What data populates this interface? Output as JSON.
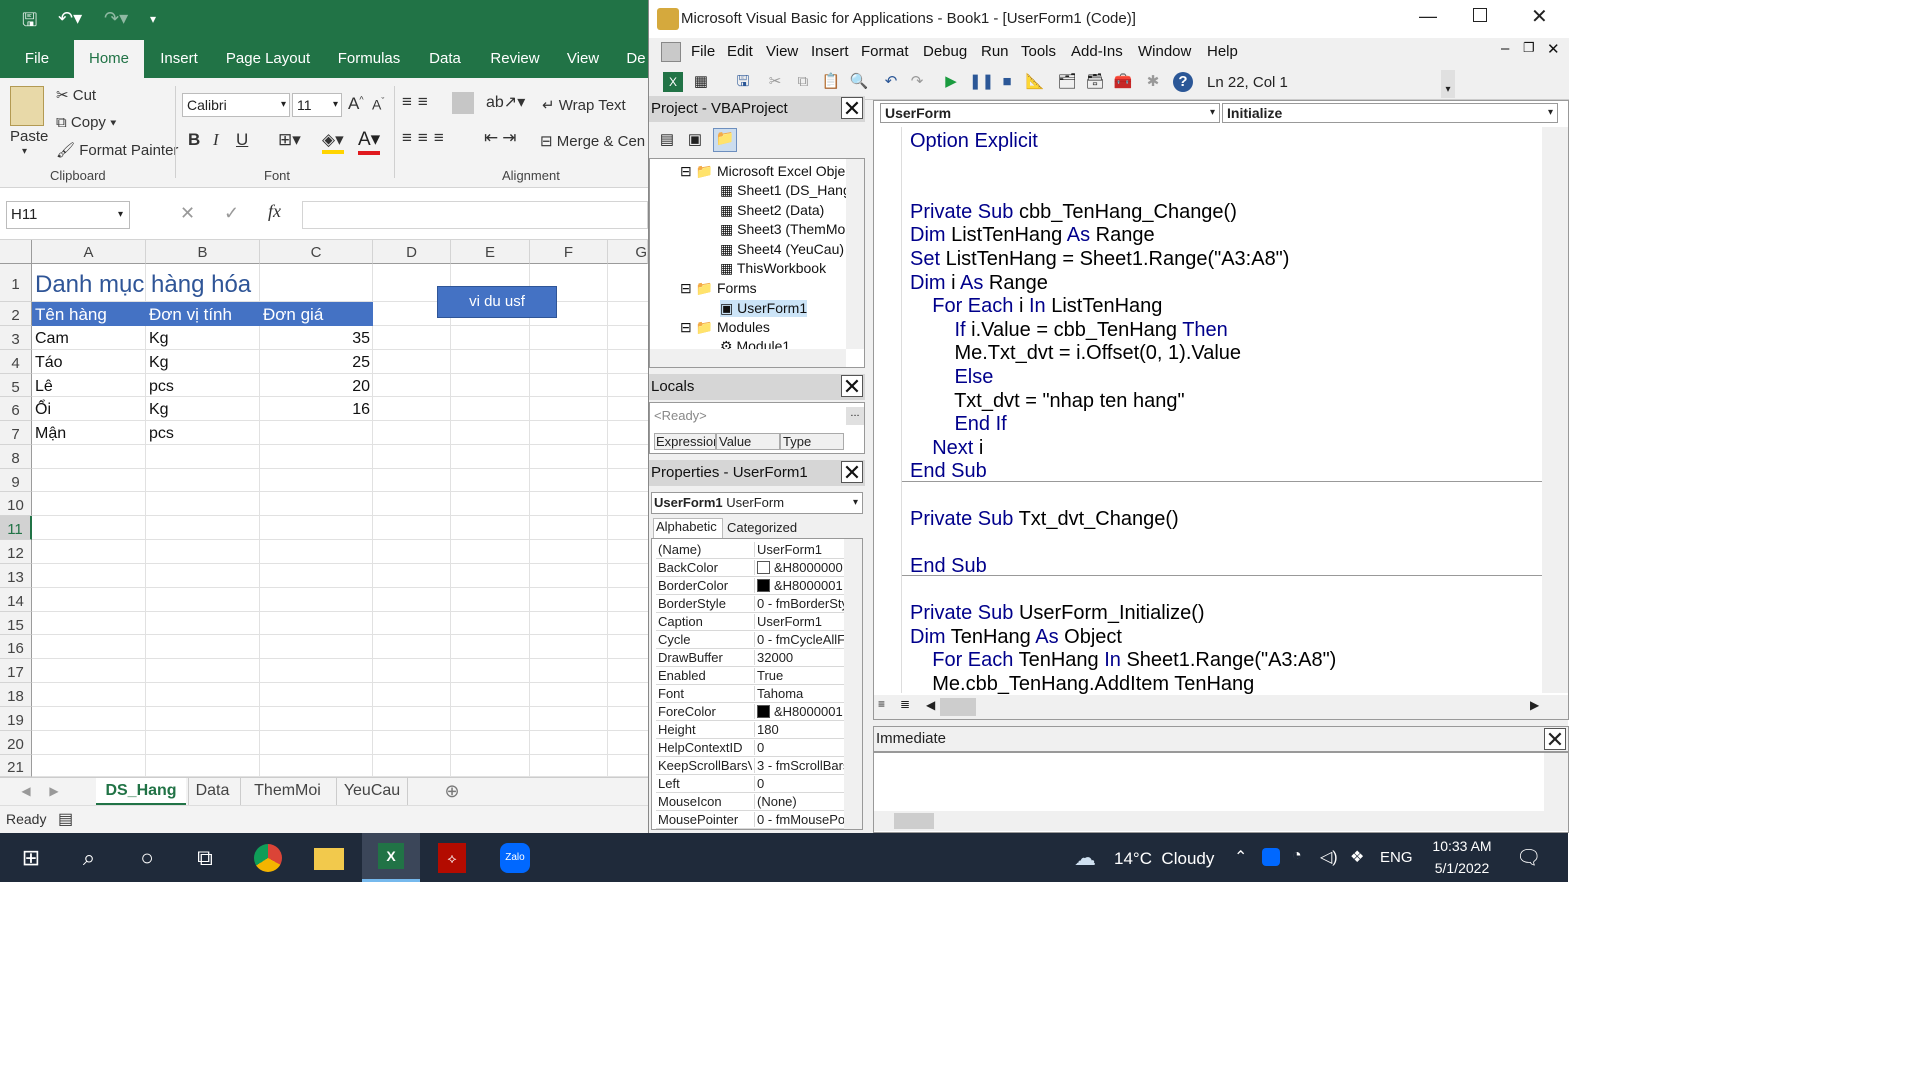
{
  "excel": {
    "ribbon_tabs": [
      "File",
      "Home",
      "Insert",
      "Page Layout",
      "Formulas",
      "Data",
      "Review",
      "View",
      "De"
    ],
    "active_tab": "Home",
    "clipboard": {
      "paste": "Paste",
      "cut": "Cut",
      "copy": "Copy",
      "format_painter": "Format Painter",
      "label": "Clipboard"
    },
    "font": {
      "name": "Calibri",
      "size": "11",
      "label": "Font",
      "bold": "B",
      "italic": "I",
      "underline": "U"
    },
    "alignment": {
      "wrap": "Wrap Text",
      "merge": "Merge & Cen",
      "label": "Alignment"
    },
    "name_box": "H11",
    "fx": "fx",
    "columns": [
      "A",
      "B",
      "C",
      "D",
      "E",
      "F",
      "G"
    ],
    "rows": [
      "1",
      "2",
      "3",
      "4",
      "5",
      "6",
      "7",
      "8",
      "9",
      "10",
      "11",
      "12",
      "13",
      "14",
      "15",
      "16",
      "17",
      "18",
      "19",
      "20",
      "21"
    ],
    "title": "Danh mục  hàng hóa",
    "headers": [
      "Tên hàng",
      "Đơn vị tính",
      "Đơn giá"
    ],
    "data": [
      [
        "Cam",
        "Kg",
        "35"
      ],
      [
        "Táo",
        "Kg",
        "25"
      ],
      [
        "Lê",
        "pcs",
        "20"
      ],
      [
        "Ổi",
        "Kg",
        "16"
      ],
      [
        "Mận",
        "pcs",
        ""
      ]
    ],
    "button_label": "vi du usf",
    "sheets": [
      "DS_Hang",
      "Data",
      "ThemMoi",
      "YeuCau"
    ],
    "active_sheet": "DS_Hang",
    "status": "Ready",
    "accent": "#217346",
    "header_fill": "#4472c4"
  },
  "vba": {
    "title": "Microsoft Visual Basic for Applications - Book1 - [UserForm1 (Code)]",
    "menu": [
      "File",
      "Edit",
      "View",
      "Insert",
      "Format",
      "Debug",
      "Run",
      "Tools",
      "Add-Ins",
      "Window",
      "Help"
    ],
    "cursor_pos": "Ln 22, Col 1",
    "project": {
      "title": "Project - VBAProject",
      "items": [
        "Microsoft Excel Objec",
        "Sheet1 (DS_Hang",
        "Sheet2 (Data)",
        "Sheet3 (ThemMoi",
        "Sheet4 (YeuCau)",
        "ThisWorkbook",
        "Forms",
        "UserForm1",
        "Modules",
        "Module1"
      ]
    },
    "locals": {
      "title": "Locals",
      "ready": "<Ready>",
      "cols": [
        "Expression",
        "Value",
        "Type"
      ]
    },
    "properties": {
      "title": "Properties - UserForm1",
      "object": "UserForm1",
      "object_type": "UserForm",
      "tabs": [
        "Alphabetic",
        "Categorized"
      ],
      "rows": [
        [
          "(Name)",
          "UserForm1"
        ],
        [
          "BackColor",
          "&H8000000"
        ],
        [
          "BorderColor",
          "&H8000001"
        ],
        [
          "BorderStyle",
          "0 - fmBorderSty"
        ],
        [
          "Caption",
          "UserForm1"
        ],
        [
          "Cycle",
          "0 - fmCycleAllF"
        ],
        [
          "DrawBuffer",
          "32000"
        ],
        [
          "Enabled",
          "True"
        ],
        [
          "Font",
          "Tahoma"
        ],
        [
          "ForeColor",
          "&H8000001"
        ],
        [
          "Height",
          "180"
        ],
        [
          "HelpContextID",
          "0"
        ],
        [
          "KeepScrollBarsVi",
          "3 - fmScrollBars"
        ],
        [
          "Left",
          "0"
        ],
        [
          "MouseIcon",
          "(None)"
        ],
        [
          "MousePointer",
          "0 - fmMousePo"
        ]
      ]
    },
    "object_dropdown": "UserForm",
    "proc_dropdown": "Initialize",
    "code_lines": [
      "Option Explicit",
      "",
      "",
      "Private Sub cbb_TenHang_Change()",
      "Dim ListTenHang As Range",
      "Set ListTenHang = Sheet1.Range(\"A3:A8\")",
      "Dim i As Range",
      "    For Each i In ListTenHang",
      "        If i.Value = cbb_TenHang Then",
      "        Me.Txt_dvt = i.Offset(0, 1).Value",
      "        Else",
      "        Txt_dvt = \"nhap ten hang\"",
      "        End If",
      "    Next i",
      "End Sub",
      "",
      "Private Sub Txt_dvt_Change()",
      "",
      "End Sub",
      "",
      "Private Sub UserForm_Initialize()",
      "Dim TenHang As Object",
      "    For Each TenHang In Sheet1.Range(\"A3:A8\")",
      "    Me.cbb_TenHang.AddItem TenHang"
    ],
    "immediate": "Immediate"
  },
  "taskbar": {
    "weather": "14°C  Cloudy",
    "lang": "ENG",
    "time": "10:33 AM",
    "date": "5/1/2022",
    "zalo": "Zalo"
  }
}
